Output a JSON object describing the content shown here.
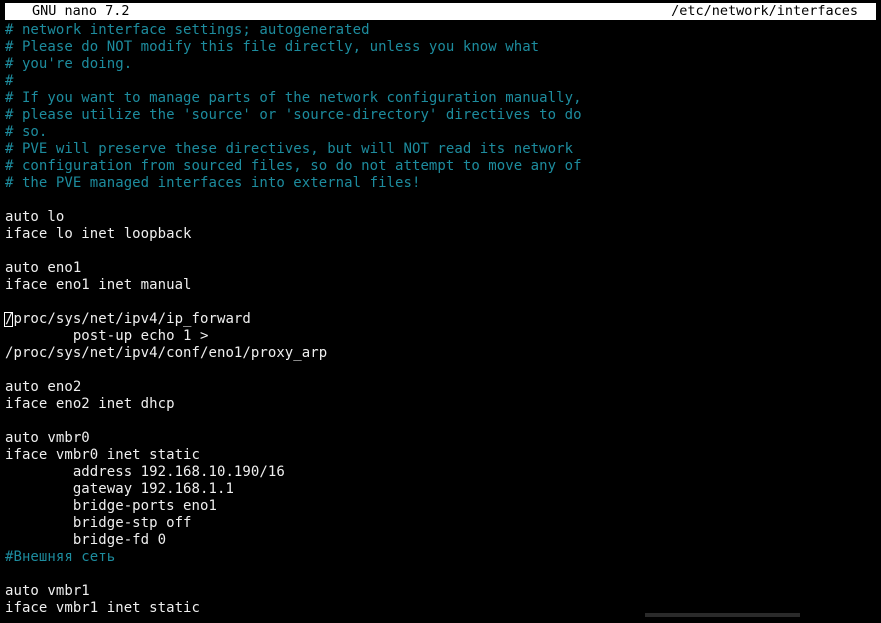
{
  "window": {
    "app_title": "GNU nano 7.2",
    "file_path": "/etc/network/interfaces"
  },
  "editor": {
    "cursor": {
      "line": 18,
      "column": 1
    },
    "lines": [
      {
        "text": "# network interface settings; autogenerated",
        "type": "comment"
      },
      {
        "text": "# Please do NOT modify this file directly, unless you know what",
        "type": "comment"
      },
      {
        "text": "# you're doing.",
        "type": "comment"
      },
      {
        "text": "#",
        "type": "comment"
      },
      {
        "text": "# If you want to manage parts of the network configuration manually,",
        "type": "comment"
      },
      {
        "text": "# please utilize the 'source' or 'source-directory' directives to do",
        "type": "comment"
      },
      {
        "text": "# so.",
        "type": "comment"
      },
      {
        "text": "# PVE will preserve these directives, but will NOT read its network",
        "type": "comment"
      },
      {
        "text": "# configuration from sourced files, so do not attempt to move any of",
        "type": "comment"
      },
      {
        "text": "# the PVE managed interfaces into external files!",
        "type": "comment"
      },
      {
        "text": "",
        "type": "plain"
      },
      {
        "text": "auto lo",
        "type": "plain"
      },
      {
        "text": "iface lo inet loopback",
        "type": "plain"
      },
      {
        "text": "",
        "type": "plain"
      },
      {
        "text": "auto eno1",
        "type": "plain"
      },
      {
        "text": "iface eno1 inet manual",
        "type": "plain"
      },
      {
        "text": "",
        "type": "plain"
      },
      {
        "text": "/proc/sys/net/ipv4/ip_forward",
        "type": "plain"
      },
      {
        "text": "        post-up echo 1 >",
        "type": "plain"
      },
      {
        "text": "/proc/sys/net/ipv4/conf/eno1/proxy_arp",
        "type": "plain"
      },
      {
        "text": "",
        "type": "plain"
      },
      {
        "text": "auto eno2",
        "type": "plain"
      },
      {
        "text": "iface eno2 inet dhcp",
        "type": "plain"
      },
      {
        "text": "",
        "type": "plain"
      },
      {
        "text": "auto vmbr0",
        "type": "plain"
      },
      {
        "text": "iface vmbr0 inet static",
        "type": "plain"
      },
      {
        "text": "        address 192.168.10.190/16",
        "type": "plain"
      },
      {
        "text": "        gateway 192.168.1.1",
        "type": "plain"
      },
      {
        "text": "        bridge-ports eno1",
        "type": "plain"
      },
      {
        "text": "        bridge-stp off",
        "type": "plain"
      },
      {
        "text": "        bridge-fd 0",
        "type": "plain"
      },
      {
        "text": "#Внешняя сеть",
        "type": "comment"
      },
      {
        "text": "",
        "type": "plain"
      },
      {
        "text": "auto vmbr1",
        "type": "plain"
      },
      {
        "text": "iface vmbr1 inet static",
        "type": "plain"
      }
    ]
  },
  "colors": {
    "background": "#000000",
    "titlebar_bg": "#ffffff",
    "titlebar_fg": "#000000",
    "comment": "#1d8c9e",
    "text": "#efefef"
  }
}
